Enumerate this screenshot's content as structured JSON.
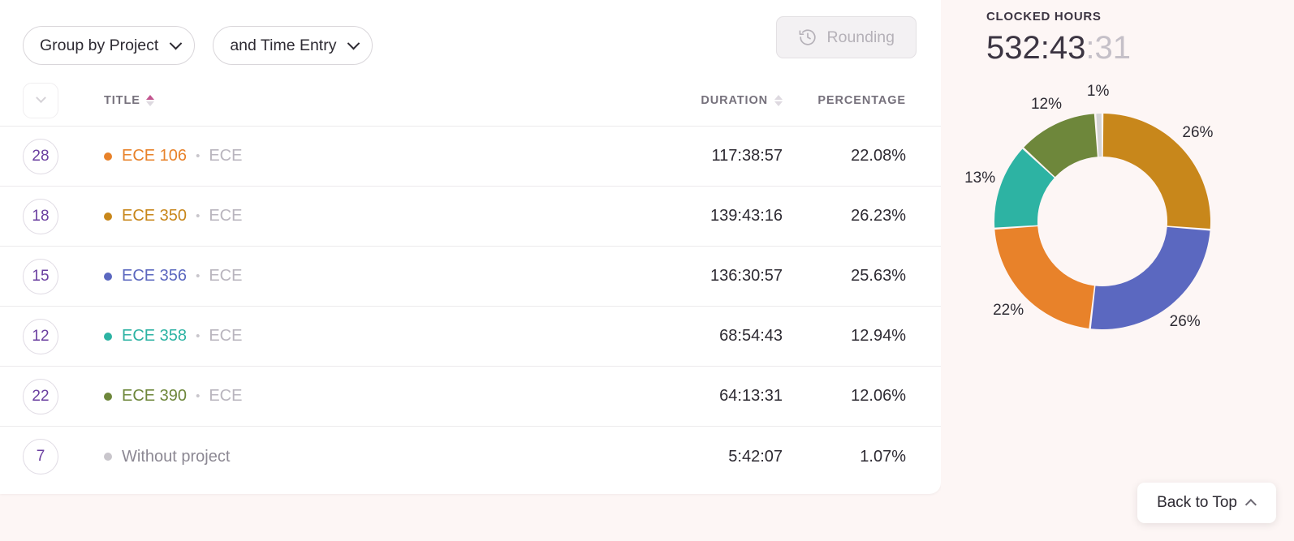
{
  "toolbar": {
    "group_by": "Group by Project",
    "and_by": "and Time Entry",
    "rounding": "Rounding",
    "rounding_icon": "clock-rewind-icon"
  },
  "table": {
    "expander_icon": "chevron-down-icon",
    "columns": {
      "title": "TITLE",
      "duration": "DURATION",
      "percentage": "PERCENTAGE"
    },
    "sort": {
      "column": "TITLE",
      "direction": "asc",
      "active_color": "#c2558f"
    },
    "rows": [
      {
        "count": "28",
        "project": "ECE 106",
        "client": "ECE",
        "duration": "117:38:57",
        "percentage": "22.08%",
        "color": "#e8822a"
      },
      {
        "count": "18",
        "project": "ECE 350",
        "client": "ECE",
        "duration": "139:43:16",
        "percentage": "26.23%",
        "color": "#c8871b"
      },
      {
        "count": "15",
        "project": "ECE 356",
        "client": "ECE",
        "duration": "136:30:57",
        "percentage": "25.63%",
        "color": "#5b68c0"
      },
      {
        "count": "12",
        "project": "ECE 358",
        "client": "ECE",
        "duration": "68:54:43",
        "percentage": "12.94%",
        "color": "#2db3a3"
      },
      {
        "count": "22",
        "project": "ECE 390",
        "client": "ECE",
        "duration": "64:13:31",
        "percentage": "12.06%",
        "color": "#6e873b"
      },
      {
        "count": "7",
        "project": "Without project",
        "client": "",
        "duration": "5:42:07",
        "percentage": "1.07%",
        "color": "#c9c6cc"
      }
    ]
  },
  "summary": {
    "label": "CLOCKED HOURS",
    "total_main": "532:43",
    "total_seconds": ":31"
  },
  "chart_data": {
    "type": "pie",
    "title": "CLOCKED HOURS",
    "donut": true,
    "legend": "none",
    "labels_format": "percent-outside",
    "start_angle_deg": 0,
    "direction": "clockwise",
    "categories": [
      "ECE 350",
      "ECE 356",
      "ECE 106",
      "ECE 358",
      "ECE 390",
      "Without project"
    ],
    "values": [
      26.23,
      25.63,
      22.08,
      12.94,
      12.06,
      1.07
    ],
    "display_labels": [
      "26%",
      "26%",
      "22%",
      "13%",
      "12%",
      "1%"
    ],
    "colors": [
      "#c8871b",
      "#5b68c0",
      "#e8822a",
      "#2db3a3",
      "#6e873b",
      "#d4d4d4"
    ],
    "durations": [
      "139:43:16",
      "136:30:57",
      "117:38:57",
      "68:54:43",
      "64:13:31",
      "5:42:07"
    ]
  },
  "footer": {
    "back_to_top": "Back to Top",
    "back_to_top_icon": "chevron-up-icon"
  }
}
